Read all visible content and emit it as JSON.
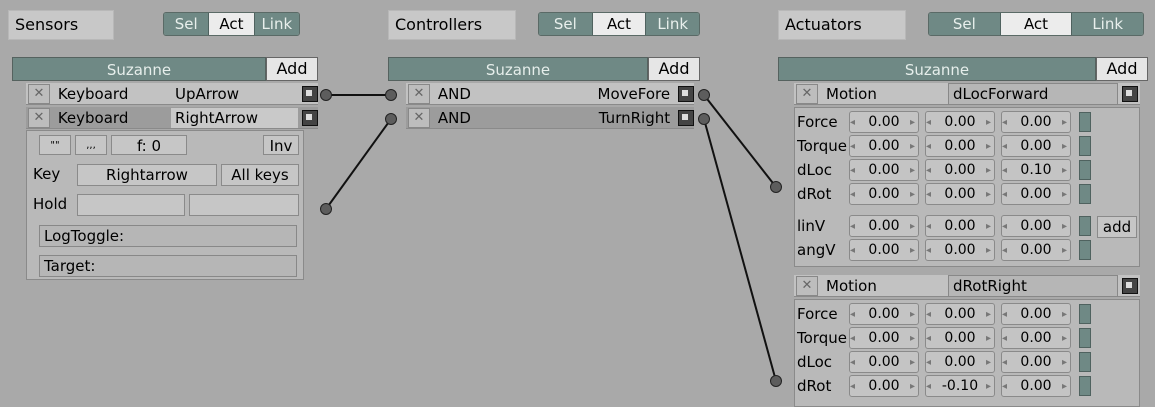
{
  "sections": {
    "sensors": {
      "title": "Sensors",
      "sel": "Sel",
      "act": "Act",
      "link": "Link"
    },
    "controllers": {
      "title": "Controllers",
      "sel": "Sel",
      "act": "Act",
      "link": "Link"
    },
    "actuators": {
      "title": "Actuators",
      "sel": "Sel",
      "act": "Act",
      "link": "Link"
    }
  },
  "object_name": "Suzanne",
  "add_label": "Add",
  "sensors": [
    {
      "type": "Keyboard",
      "name": "UpArrow"
    },
    {
      "type": "Keyboard",
      "name": "RightArrow"
    }
  ],
  "sensor_detail": {
    "pulse_true": "\"\"",
    "pulse_false": ",,,",
    "freq": "f: 0",
    "inv": "Inv",
    "key_label": "Key",
    "key_value": "Rightarrow",
    "all_keys": "All keys",
    "hold_label": "Hold",
    "logtoggle": "LogToggle:",
    "target": "Target:"
  },
  "controllers": [
    {
      "type": "AND",
      "name": "MoveFore"
    },
    {
      "type": "AND",
      "name": "TurnRight"
    }
  ],
  "actuators": [
    {
      "type": "Motion",
      "name": "dLocForward",
      "rows": [
        {
          "label": "Force",
          "values": [
            "0.00",
            "0.00",
            "0.00"
          ],
          "flag": "L"
        },
        {
          "label": "Torque",
          "values": [
            "0.00",
            "0.00",
            "0.00"
          ],
          "flag": "L"
        },
        {
          "label": "dLoc",
          "values": [
            "0.00",
            "0.00",
            "0.10"
          ],
          "flag": "L"
        },
        {
          "label": "dRot",
          "values": [
            "0.00",
            "0.00",
            "0.00"
          ],
          "flag": "L"
        },
        {
          "label": "linV",
          "values": [
            "0.00",
            "0.00",
            "0.00"
          ],
          "flag": "L"
        },
        {
          "label": "angV",
          "values": [
            "0.00",
            "0.00",
            "0.00"
          ],
          "flag": "L"
        }
      ],
      "add": "add"
    },
    {
      "type": "Motion",
      "name": "dRotRight",
      "rows": [
        {
          "label": "Force",
          "values": [
            "0.00",
            "0.00",
            "0.00"
          ],
          "flag": "L"
        },
        {
          "label": "Torque",
          "values": [
            "0.00",
            "0.00",
            "0.00"
          ],
          "flag": "L"
        },
        {
          "label": "dLoc",
          "values": [
            "0.00",
            "0.00",
            "0.00"
          ],
          "flag": "L"
        },
        {
          "label": "dRot",
          "values": [
            "0.00",
            "-0.10",
            "0.00"
          ],
          "flag": "L"
        }
      ]
    }
  ]
}
